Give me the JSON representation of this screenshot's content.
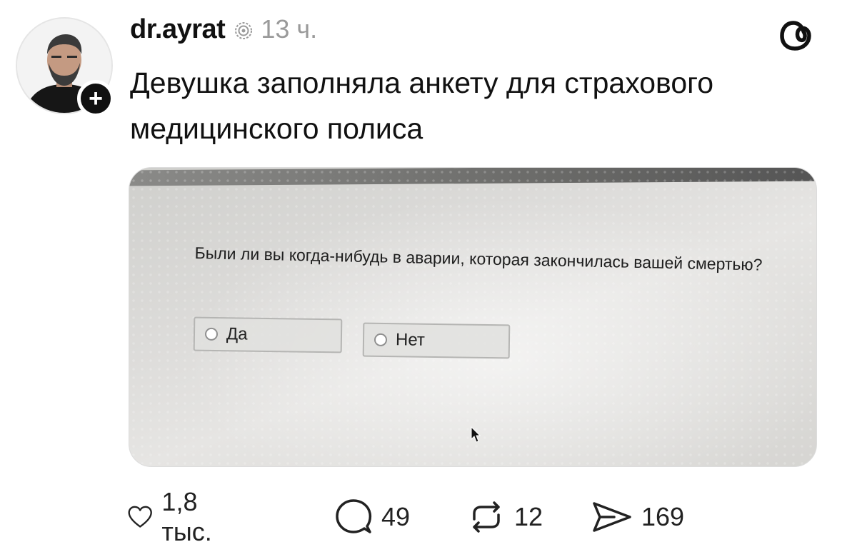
{
  "post": {
    "username": "dr.ayrat",
    "time": "13 ч.",
    "text": "Девушка заполняла анкету для страхового медицинского полиса"
  },
  "photo": {
    "question": "Были ли вы когда-нибудь в аварии, которая закончилась вашей смертью?",
    "option_yes": "Да",
    "option_no": "Нет"
  },
  "actions": {
    "likes": "1,8 тыс.",
    "replies": "49",
    "reposts": "12",
    "shares": "169"
  },
  "icons": {
    "verified": "verified-icon",
    "threads": "threads-logo-icon",
    "like": "heart-icon",
    "reply": "comment-icon",
    "repost": "repost-icon",
    "share": "send-icon"
  }
}
